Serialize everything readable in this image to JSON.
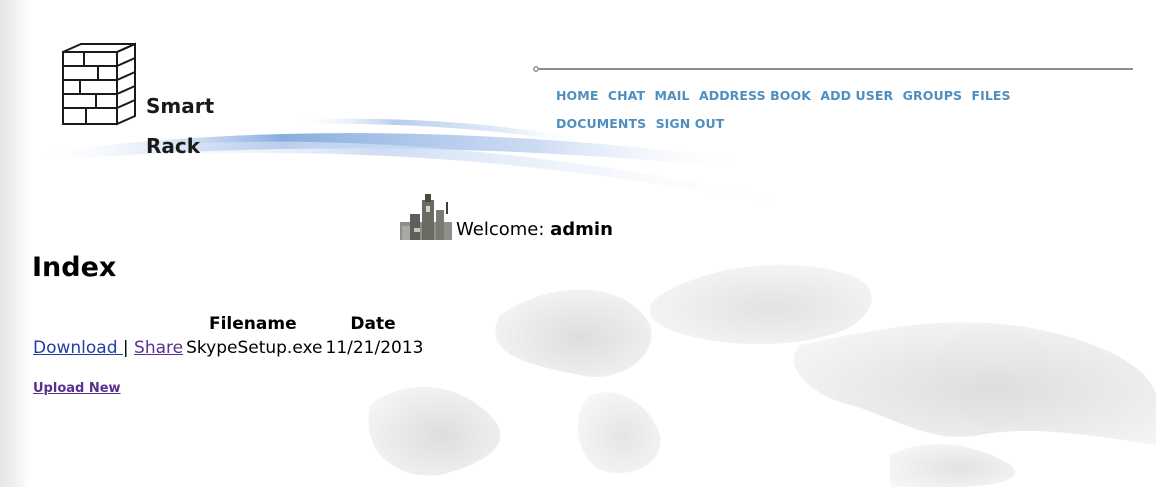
{
  "brand": {
    "line1": "Smart",
    "line2": "Rack"
  },
  "nav": {
    "items": [
      {
        "label": "HOME"
      },
      {
        "label": "CHAT"
      },
      {
        "label": "MAIL"
      },
      {
        "label": "ADDRESS BOOK"
      },
      {
        "label": "ADD USER"
      },
      {
        "label": "GROUPS"
      },
      {
        "label": "FILES"
      },
      {
        "label": "DOCUMENTS"
      },
      {
        "label": "SIGN OUT"
      }
    ]
  },
  "welcome": {
    "prefix": "Welcome:",
    "username": "admin"
  },
  "page": {
    "title": "Index"
  },
  "table": {
    "headers": {
      "filename": "Filename",
      "date": "Date"
    },
    "rows": [
      {
        "download_label": "Download ",
        "separator": "|",
        "share_label": "Share",
        "filename": "SkypeSetup.exe",
        "date": "11/21/2013"
      }
    ]
  },
  "actions": {
    "upload_new": "Upload New"
  },
  "colors": {
    "nav_link": "#4f8fbf",
    "link": "#1f3fa6",
    "visited_link": "#5a2f8f",
    "swoosh": "#7aa3dc"
  }
}
